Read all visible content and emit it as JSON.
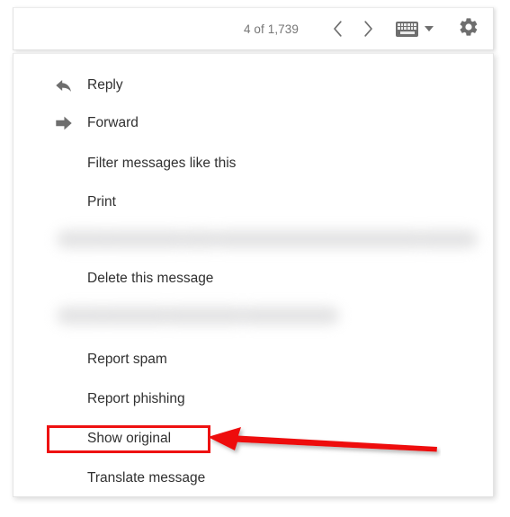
{
  "window": {
    "title": "Gmail message options menu"
  },
  "toolbar": {
    "pager_count": "4 of 1,739",
    "prev_label": "‹",
    "next_label": "›",
    "keyboard_icon_name": "keyboard-icon",
    "caret_label": "▾",
    "gear_icon_name": "gear-icon",
    "icon_color": "#6e6e6e",
    "text_color": "#767676"
  },
  "menu": {
    "items": [
      {
        "label": "Reply",
        "icon": "reply-arrow-icon",
        "redacted": false
      },
      {
        "label": "Forward",
        "icon": "forward-arrow-icon",
        "redacted": false
      },
      {
        "label": "Filter messages like this",
        "icon": "",
        "redacted": false
      },
      {
        "label": "Print",
        "icon": "",
        "redacted": false
      },
      {
        "label": "",
        "icon": "",
        "redacted": true
      },
      {
        "label": "Delete this message",
        "icon": "",
        "redacted": false
      },
      {
        "label": "",
        "icon": "",
        "redacted": true
      },
      {
        "label": "Report spam",
        "icon": "",
        "redacted": false
      },
      {
        "label": "Report phishing",
        "icon": "",
        "redacted": false
      },
      {
        "label": "Show original",
        "icon": "",
        "redacted": false,
        "highlighted": true
      },
      {
        "label": "Translate message",
        "icon": "",
        "redacted": false
      }
    ]
  },
  "annotation": {
    "highlight_color": "#ee1111",
    "arrow_color": "#ee1111",
    "target_label": "Show original",
    "arrow_direction": "left"
  },
  "colors": {
    "panel_background": "#ffffff",
    "border": "#e4e4e4",
    "menu_text": "#303030",
    "redacted_blob": "#dededf"
  }
}
